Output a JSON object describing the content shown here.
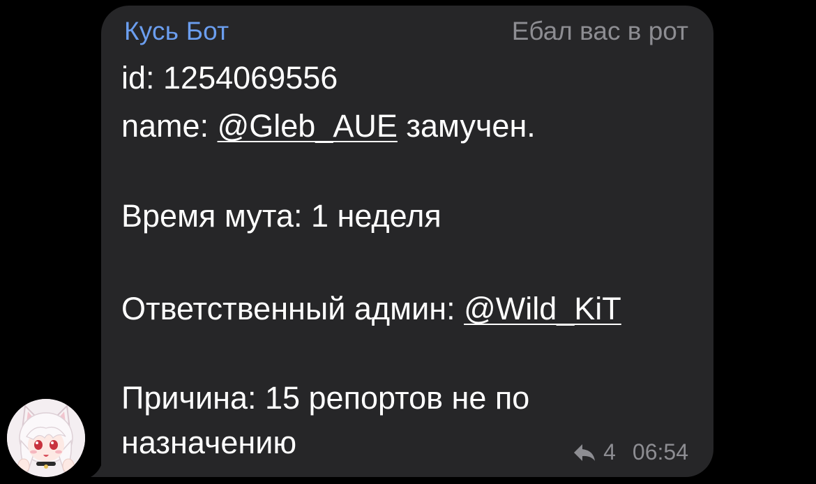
{
  "message": {
    "sender": "Кусь Бот",
    "admin_title": "Ебал вас в рот",
    "id_line": "id: 1254069556",
    "name_prefix": "name: ",
    "name_link": "@Gleb_AUE",
    "name_suffix": " замучен.",
    "mute_time": "Время мута: 1 неделя",
    "admin_prefix": "Ответственный админ: ",
    "admin_link": "@Wild_KiT",
    "reason_line1": "Причина: 15 репортов не по",
    "reason_line2": "назначению",
    "reply_count": "4",
    "time": "06:54"
  },
  "icons": {
    "reply": "reply-arrow-icon",
    "avatar": "anime-cat-girl-avatar"
  },
  "colors": {
    "background": "#000000",
    "bubble": "#262628",
    "sender": "#6b9eef",
    "meta": "#8d8d92",
    "text": "#ffffff"
  }
}
